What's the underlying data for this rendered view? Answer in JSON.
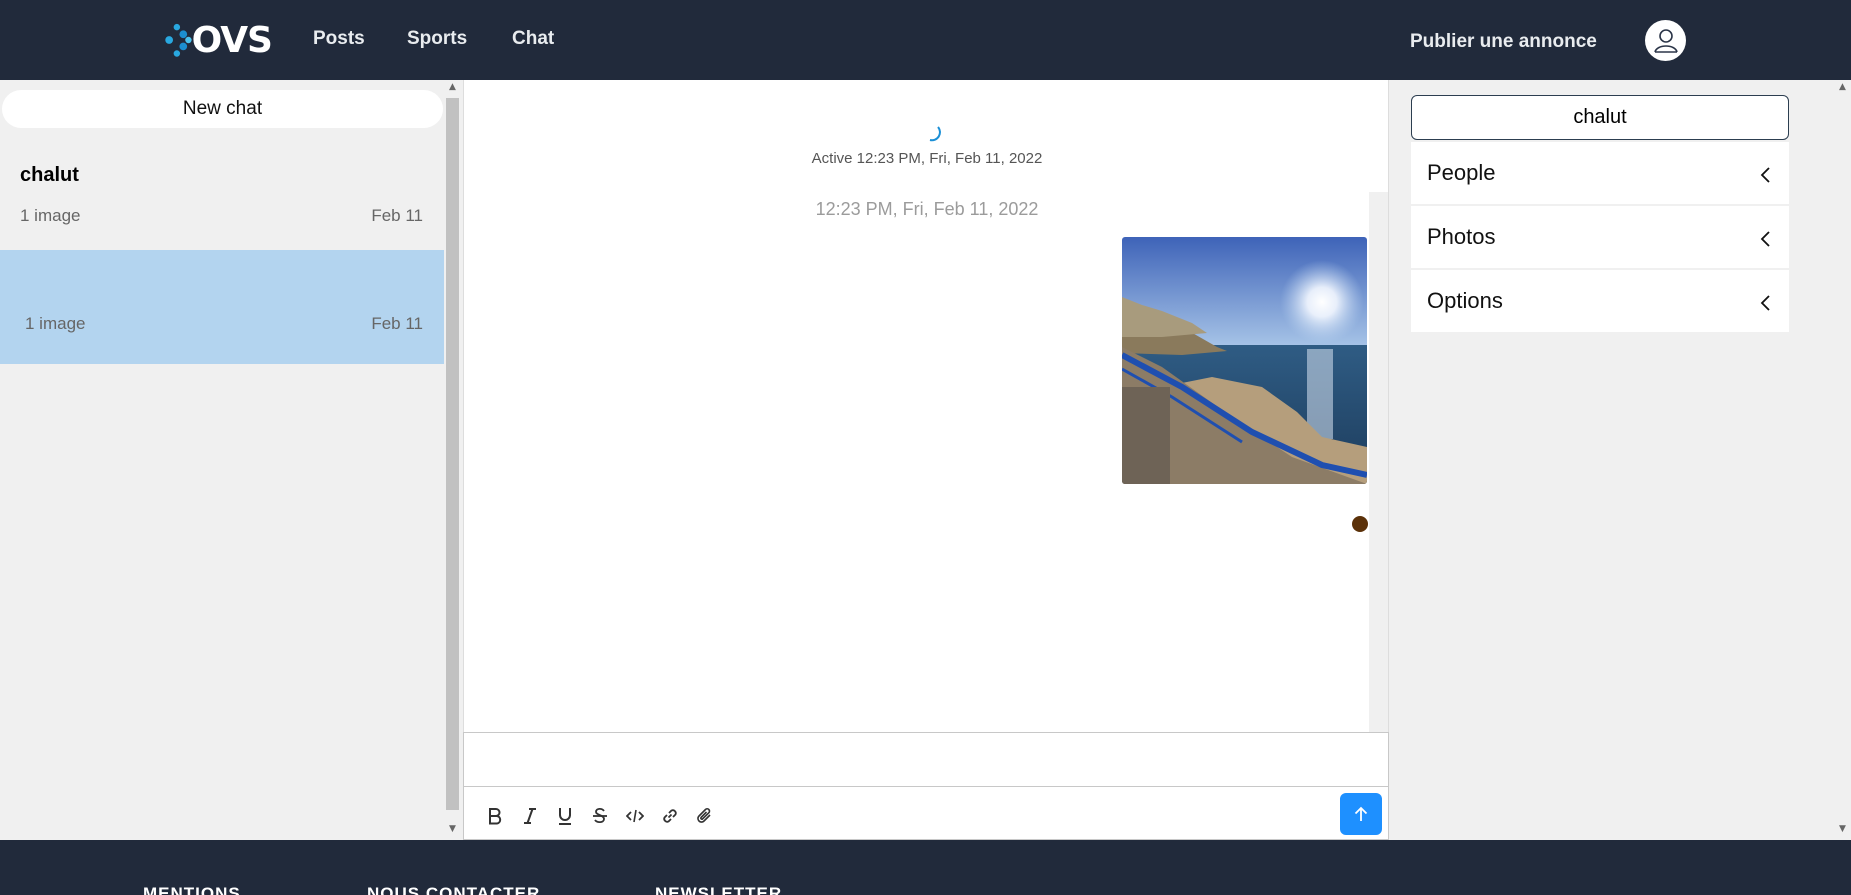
{
  "header": {
    "logo_text": "OVS",
    "nav": [
      "Posts",
      "Sports",
      "Chat"
    ],
    "publish_label": "Publier une annonce",
    "avatar_icon": "user-icon"
  },
  "chat_list": {
    "new_chat_label": "New chat",
    "items": [
      {
        "title": "chalut",
        "subtitle": "1 image",
        "date": "Feb 11",
        "selected": false
      },
      {
        "title": "",
        "subtitle": "1 image",
        "date": "Feb 11",
        "selected": true
      }
    ]
  },
  "feed": {
    "active_text": "Active 12:23 PM, Fri, Feb 11, 2022",
    "timestamp": "12:23 PM, Fri, Feb 11, 2022",
    "message_image_alt": "seaside-photo"
  },
  "composer": {
    "placeholder": "",
    "tools": [
      "bold-icon",
      "italic-icon",
      "underline-icon",
      "strikethrough-icon",
      "code-icon",
      "link-icon",
      "attachment-icon"
    ],
    "send_icon": "arrow-up-icon"
  },
  "details": {
    "title": "chalut",
    "sections": [
      "People",
      "Photos",
      "Options"
    ]
  },
  "footer": {
    "headings": [
      "MENTIONS",
      "NOUS CONTACTER",
      "NEWSLETTER"
    ]
  },
  "colors": {
    "navbar": "#212a3b",
    "selected_chat": "#b3d4ef",
    "send_button": "#1e90ff",
    "read_dot": "#5b3109"
  }
}
